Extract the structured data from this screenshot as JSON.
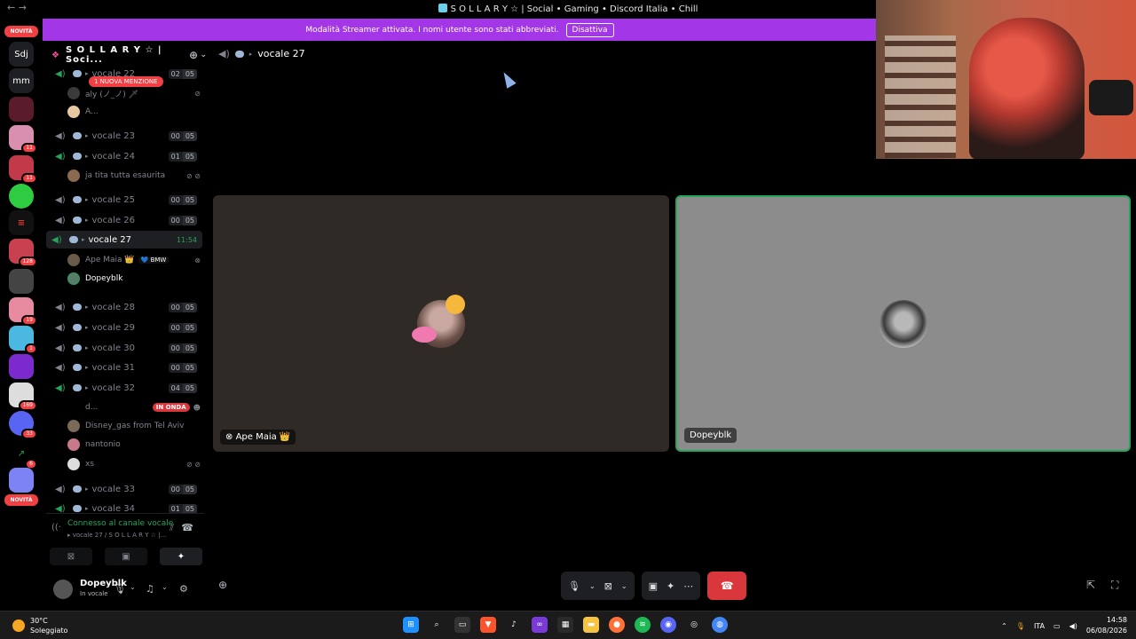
{
  "window": {
    "title": "S O L L A R Y ☆ | Social • Gaming • Discord Italia • Chill",
    "nav": "← →"
  },
  "banner": {
    "text": "Modalità Streamer attivata. I nomi utente sono stati abbreviati.",
    "button": "Disattiva"
  },
  "rail": {
    "new_label_top": "NOVITÀ",
    "new_label_bottom": "NOVITÀ",
    "text_servers": [
      "Sdj",
      "mm"
    ],
    "badges": [
      "11",
      "11",
      "128",
      "19",
      "1",
      "169",
      "33",
      "6"
    ]
  },
  "server": {
    "name": "S O L L A R Y ☆ | Soci...",
    "chevron": "⌄",
    "invite_icon": "person-add-icon"
  },
  "mention_pill": "1 NUOVA MENZIONE",
  "channels": [
    {
      "name": "vocale 22",
      "a": "02",
      "b": "05"
    },
    {
      "name": "vocale 23",
      "a": "00",
      "b": "05"
    },
    {
      "name": "vocale 24",
      "a": "01",
      "b": "05"
    },
    {
      "name": "vocale 25",
      "a": "00",
      "b": "05"
    },
    {
      "name": "vocale 26",
      "a": "00",
      "b": "05"
    },
    {
      "name": "vocale 27",
      "time": "11:54"
    },
    {
      "name": "vocale 28",
      "a": "00",
      "b": "05"
    },
    {
      "name": "vocale 29",
      "a": "00",
      "b": "05"
    },
    {
      "name": "vocale 30",
      "a": "00",
      "b": "05"
    },
    {
      "name": "vocale 31",
      "a": "00",
      "b": "05"
    },
    {
      "name": "vocale 32",
      "a": "04",
      "b": "05"
    },
    {
      "name": "vocale 33",
      "a": "00",
      "b": "05"
    },
    {
      "name": "vocale 34",
      "a": "01",
      "b": "05"
    }
  ],
  "users": {
    "u22a": "aly (ノ_ノ) 🗡",
    "u22b": "A...",
    "u24a": "ja tita tutta esaurita",
    "u27a": "Ape Maia 👑",
    "u27a_tag": "💙 BMW",
    "u27b": "Dopeyblk",
    "u32a": "d...",
    "u32a_live": "IN ONDA",
    "u32b": "Disney_gas from Tel Aviv",
    "u32c": "nantonio",
    "u32d": "xs"
  },
  "voice_panel": {
    "status": "Connesso al canale vocale",
    "sub": "▸ vocale 27 / S O L L A R Y ☆ |..."
  },
  "userbar": {
    "name": "Dopeyblk",
    "status": "In vocale"
  },
  "main": {
    "channel": "vocale 27"
  },
  "tiles": [
    {
      "label": "Ape Maia 👑",
      "platform_icon": "xbox-icon"
    },
    {
      "label": "Dopeyblk"
    }
  ],
  "taskbar": {
    "temp": "30°C",
    "weather": "Soleggiato",
    "lang": "ITA",
    "time": "14:58",
    "date": "06/08/2026"
  },
  "colors": {
    "accent": "#a337e8",
    "green": "#23a55a",
    "red": "#da373c"
  }
}
